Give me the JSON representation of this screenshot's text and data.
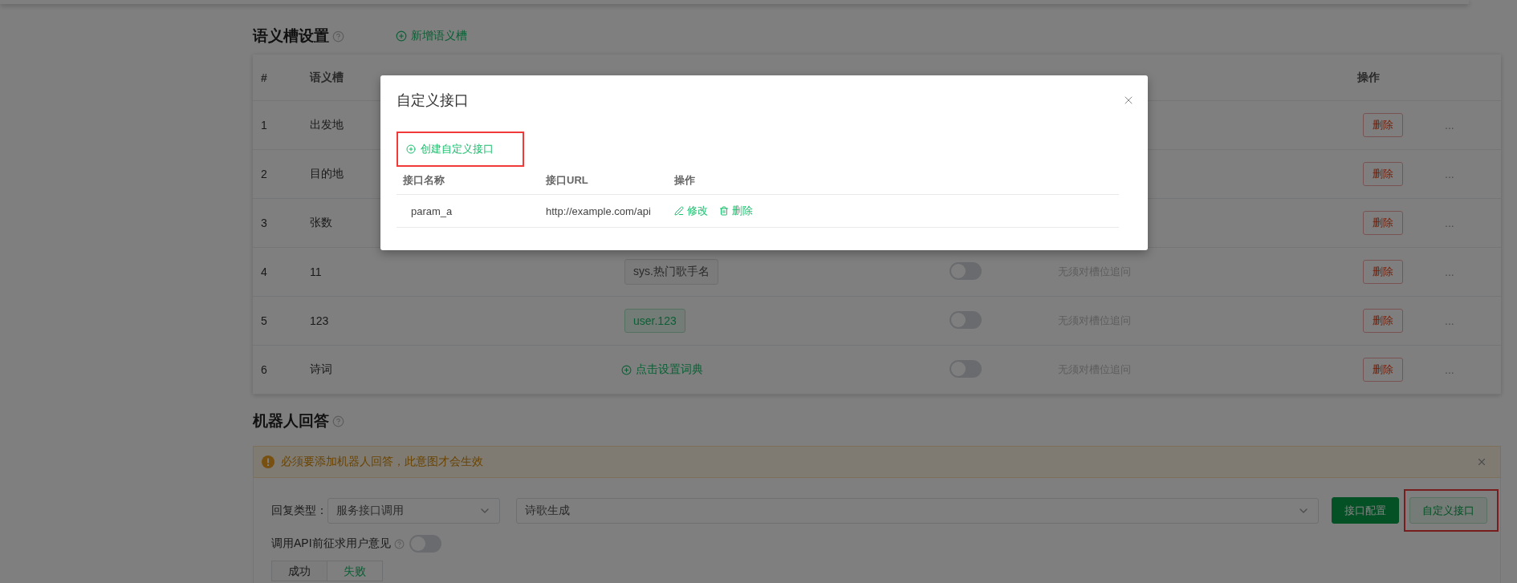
{
  "slot_section": {
    "title": "语义槽设置",
    "add_link": "新增语义槽"
  },
  "slot_table": {
    "columns": [
      "#",
      "语义槽",
      "操作"
    ],
    "rows": [
      {
        "index": "1",
        "name": "出发地",
        "delete": "删除",
        "more": "..."
      },
      {
        "index": "2",
        "name": "目的地",
        "delete": "删除",
        "more": "..."
      },
      {
        "index": "3",
        "name": "张数",
        "delete": "删除",
        "more": "..."
      },
      {
        "index": "4",
        "name": "11",
        "dict": {
          "kind": "system",
          "text": "sys.热门歌手名"
        },
        "ask": {
          "on": false
        },
        "followup": "无须对槽位追问",
        "delete": "删除",
        "more": "..."
      },
      {
        "index": "5",
        "name": "123",
        "dict": {
          "kind": "user",
          "text": "user.123"
        },
        "ask": {
          "on": false
        },
        "followup": "无须对槽位追问",
        "delete": "删除",
        "more": "..."
      },
      {
        "index": "6",
        "name": "诗词",
        "dict": {
          "kind": "link",
          "text": "点击设置词典"
        },
        "ask": {
          "on": false
        },
        "followup": "无须对槽位追问",
        "delete": "删除",
        "more": "..."
      }
    ]
  },
  "reply_section": {
    "title": "机器人回答",
    "alert": "必须要添加机器人回答，此意图才会生效",
    "type_label": "回复类型：",
    "type_value": "服务接口调用",
    "service_value": "诗歌生成",
    "buttons": [
      {
        "kind": "primary",
        "label": "接口配置",
        "highlighted": false
      },
      {
        "kind": "secondary",
        "label": "自定义接口",
        "highlighted": true
      }
    ],
    "consent": {
      "label": "调用API前征求用户意见",
      "on": false
    },
    "tabs": [
      {
        "label": "成功",
        "selected": false
      },
      {
        "label": "失败",
        "selected": true
      }
    ]
  },
  "modal": {
    "title": "自定义接口",
    "create_link": {
      "label": "创建自定义接口",
      "highlighted": true
    },
    "columns": [
      "接口名称",
      "接口URL",
      "操作"
    ],
    "rows": [
      {
        "name": "param_a",
        "url": "http://example.com/api",
        "actions": [
          {
            "kind": "edit",
            "label": "修改"
          },
          {
            "kind": "delete",
            "label": "删除"
          }
        ]
      }
    ]
  }
}
